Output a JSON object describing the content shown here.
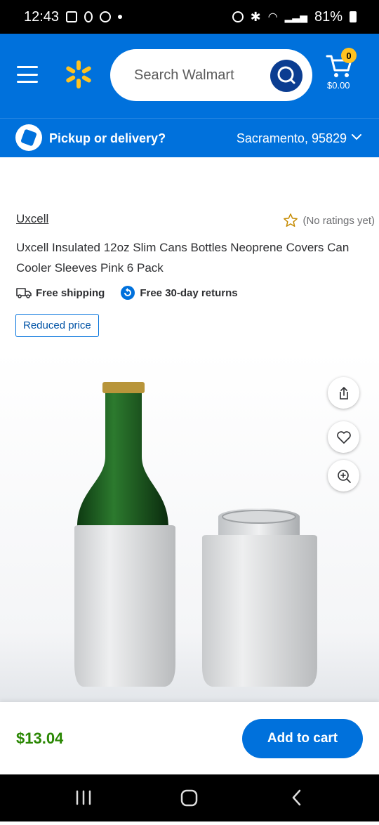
{
  "status_bar": {
    "time": "12:43",
    "battery": "81%"
  },
  "header": {
    "search_placeholder": "Search Walmart",
    "cart_count": "0",
    "cart_total": "$0.00"
  },
  "pickup": {
    "label": "Pickup or delivery?",
    "location": "Sacramento, 95829"
  },
  "product": {
    "brand": "Uxcell",
    "ratings_text": "(No ratings yet)",
    "title": "Uxcell Insulated 12oz Slim Cans Bottles Neoprene Covers Can Cooler Sleeves Pink 6 Pack",
    "free_shipping": "Free shipping",
    "free_returns": "Free 30-day returns",
    "tag": "Reduced price",
    "price": "$13.04",
    "add_to_cart": "Add to cart"
  },
  "colors": {
    "brand_blue": "#0071dc",
    "spark_yellow": "#ffc220",
    "price_green": "#2a8703"
  }
}
